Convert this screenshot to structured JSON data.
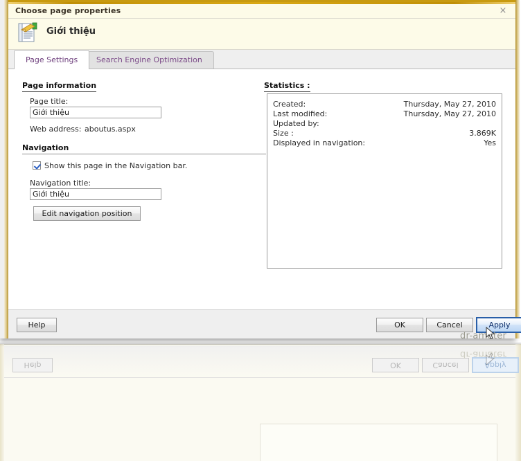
{
  "window": {
    "title": "Choose page properties",
    "close_label": "×",
    "page_icon": "page-edit-icon",
    "page_name": "Giới thiệu"
  },
  "tabs": [
    {
      "label": "Page Settings",
      "active": true
    },
    {
      "label": "Search Engine Optimization",
      "active": false
    }
  ],
  "page_information": {
    "heading": "Page information",
    "page_title_label": "Page title:",
    "page_title_value": "Giới thiệu",
    "page_title_placeholder": "",
    "web_address_label": "Web address:",
    "web_address_value": "aboutus.aspx"
  },
  "navigation": {
    "heading": "Navigation",
    "show_in_nav_label": "Show this page in the Navigation bar.",
    "show_in_nav_checked": true,
    "nav_title_label": "Navigation title:",
    "nav_title_value": "Giới thiệu",
    "nav_title_placeholder": "",
    "edit_position_button": "Edit navigation position"
  },
  "statistics": {
    "heading": "Statistics :",
    "rows": [
      {
        "key": "Created:",
        "value": "Thursday, May 27, 2010"
      },
      {
        "key": "Last modified:",
        "value": "Thursday, May 27, 2010"
      },
      {
        "key": "Updated by:",
        "value": ""
      },
      {
        "key": "Size :",
        "value": "3.869K"
      },
      {
        "key": "Displayed in navigation:",
        "value": "Yes"
      }
    ]
  },
  "footer": {
    "help_label": "Help",
    "ok_label": "OK",
    "cancel_label": "Cancel",
    "apply_label": "Apply"
  },
  "overlay": {
    "watermark": "dr-amater",
    "cursor": "mouse-pointer"
  },
  "colors": {
    "title_border_gold": "#c89a10",
    "title_bg": "#fdfbe8",
    "tab_text": "#7b4a88",
    "apply_border": "#2a5fa8",
    "checkbox_check": "#2b5fc4",
    "dialog_bg": "#efefef",
    "body_bg": "#ffffff",
    "backdrop_bg": "#fbfaf2"
  }
}
